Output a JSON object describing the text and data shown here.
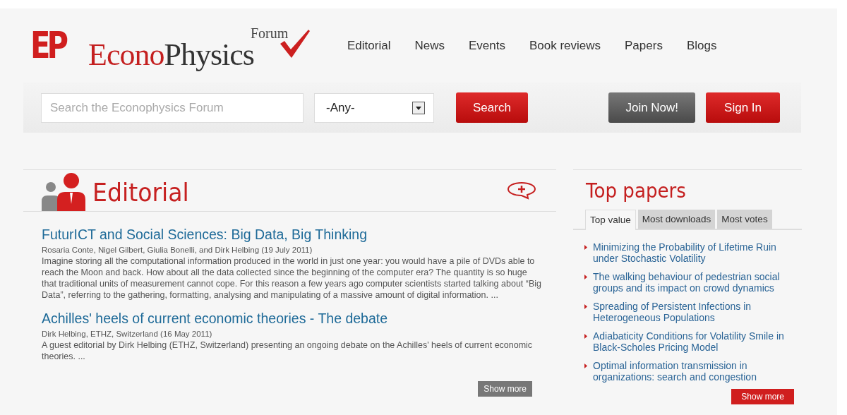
{
  "logo": {
    "mark": "EP",
    "name_red": "Econo",
    "name_dark": "Physics",
    "forum": "Forum"
  },
  "nav": [
    {
      "label": "Editorial"
    },
    {
      "label": "News"
    },
    {
      "label": "Events"
    },
    {
      "label": "Book reviews"
    },
    {
      "label": "Papers"
    },
    {
      "label": "Blogs"
    }
  ],
  "search": {
    "placeholder": "Search the Econophysics Forum",
    "scope": "-Any-",
    "button": "Search"
  },
  "account": [
    {
      "label": "Join Now!",
      "kind": "dark"
    },
    {
      "label": "Sign In",
      "kind": "red"
    }
  ],
  "editorial": {
    "title": "Editorial",
    "show_more": "Show more",
    "articles": [
      {
        "title": "FuturICT and Social Sciences: Big Data, Big Thinking",
        "byline": "Rosaria Conte, Nigel Gilbert, Giulia Bonelli, and Dirk Helbing (19 July 2011)",
        "summary": "Imagine storing all the computational information produced in the world in just one year: you would have a pile of DVDs able to reach the Moon and back. How about all the data collected since the beginning of the computer era? The quantity is so huge that traditional units of measurement cannot cope. For this reason a few years ago computer scientists started talking about “Big Data”, referring to the gathering, formatting, analysing and manipulating of a massive amount of digital information. ..."
      },
      {
        "title": "Achilles' heels of current economic theories - The debate",
        "byline": "Dirk Helbing, ETHZ, Switzerland (16 May 2011)",
        "summary": "A guest editorial by Dirk Helbing (ETHZ, Switzerland) presenting an ongoing debate on the Achilles' heels of current economic theories. ..."
      }
    ]
  },
  "top_papers": {
    "title": "Top papers",
    "show_more": "Show more",
    "tabs": [
      {
        "label": "Top value",
        "selected": true
      },
      {
        "label": "Most downloads",
        "selected": false
      },
      {
        "label": "Most votes",
        "selected": false
      }
    ],
    "items": [
      "Minimizing the Probability of Lifetime Ruin under Stochastic Volatility",
      "The walking behaviour of pedestrian social groups and its impact on crowd dynamics",
      "Spreading of Persistent Infections in Heterogeneous Populations",
      "Adiabaticity Conditions for Volatility Smile in Black-Scholes Pricing Model",
      "Optimal information transmission in organizations: search and congestion"
    ]
  }
}
